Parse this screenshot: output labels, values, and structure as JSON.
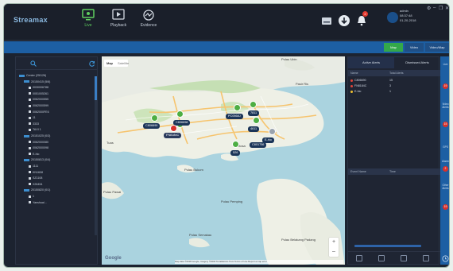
{
  "app": {
    "logo_main": "Streamax",
    "logo_accent": ""
  },
  "nav": [
    {
      "label": "Live",
      "icon": "monitor-icon",
      "active": true
    },
    {
      "label": "Playback",
      "icon": "play-icon",
      "active": false
    },
    {
      "label": "Evidence",
      "icon": "evidence-icon",
      "active": false
    }
  ],
  "topright": {
    "storage_icon": "storage-icon",
    "download_icon": "download-icon",
    "alarm_icon": "bell-icon",
    "alarm_count": "2"
  },
  "user": {
    "name": "admin",
    "time": "08:37:48",
    "date": "01-20-2018"
  },
  "window_controls": {
    "settings": "⚙",
    "minimize": "–",
    "restore": "❐",
    "close": "✕"
  },
  "view_tabs": [
    {
      "label": "Map",
      "active": true
    },
    {
      "label": "Video",
      "active": false
    },
    {
      "label": "Video/Map",
      "active": false
    }
  ],
  "tree": {
    "items": [
      {
        "label": "Center (25/126)",
        "level": 0,
        "type": "root"
      },
      {
        "label": "20150415 (5/6)",
        "level": 1,
        "type": "group"
      },
      {
        "label": "0030006788",
        "level": 2,
        "type": "vehicle"
      },
      {
        "label": "0051005261",
        "level": 2,
        "type": "vehicle"
      },
      {
        "label": "0062000555",
        "level": 2,
        "type": "vehicle"
      },
      {
        "label": "0062000599",
        "level": 2,
        "type": "vehicle"
      },
      {
        "label": "0062000FE6",
        "level": 2,
        "type": "vehicle"
      },
      {
        "label": "11",
        "level": 2,
        "type": "vehicle"
      },
      {
        "label": "3333",
        "level": 2,
        "type": "vehicle"
      },
      {
        "label": "TAXI 1",
        "level": 2,
        "type": "vehicle"
      },
      {
        "label": "20151025 (0/3)",
        "level": 1,
        "type": "group"
      },
      {
        "label": "0062000080",
        "level": 2,
        "type": "vehicle"
      },
      {
        "label": "0062000098",
        "level": 2,
        "type": "vehicle"
      },
      {
        "label": "E-hio",
        "level": 2,
        "type": "vehicle"
      },
      {
        "label": "20150813 (0/4)",
        "level": 1,
        "type": "group"
      },
      {
        "label": "1111",
        "level": 2,
        "type": "vehicle"
      },
      {
        "label": "KN1608",
        "level": 2,
        "type": "vehicle"
      },
      {
        "label": "SZ1108",
        "level": 2,
        "type": "vehicle"
      },
      {
        "label": "X26454",
        "level": 2,
        "type": "vehicle"
      },
      {
        "label": "20150820 (0/1)",
        "level": 1,
        "type": "group"
      },
      {
        "label": "1",
        "level": 2,
        "type": "vehicle"
      },
      {
        "label": "Yanshuai...",
        "level": 2,
        "type": "vehicle"
      }
    ]
  },
  "map": {
    "map_btn": "Map",
    "sat_btn": "Satellite",
    "places": [
      {
        "name": "Pulau Ubin",
        "color": "#3a3a3a"
      },
      {
        "name": "Pasir Ris",
        "color": "#3a3a3a"
      },
      {
        "name": "Pulau Semakau",
        "color": "#3a3a3a"
      },
      {
        "name": "Pulau Pawai",
        "color": "#3a3a3a"
      },
      {
        "name": "Pulau Bukom",
        "color": "#3a3a3a"
      },
      {
        "name": "Pulau Pemping",
        "color": "#3a3a3a"
      },
      {
        "name": "Pulau Belakang Padang",
        "color": "#3a3a3a"
      },
      {
        "name": "Tuas",
        "color": "#3a3a3a"
      },
      {
        "name": "Sentosa",
        "color": "#3a3a3a"
      }
    ],
    "vehicles": [
      {
        "label": "C806690",
        "status": "online"
      },
      {
        "label": "C806698",
        "status": "online"
      },
      {
        "label": "FN8184C",
        "status": "alarm"
      },
      {
        "label": "PC0568J",
        "status": "online"
      },
      {
        "label": "7811",
        "status": "online"
      },
      {
        "label": "4611",
        "status": "online"
      },
      {
        "label": "C801756",
        "status": "online"
      },
      {
        "label": "E-hio",
        "status": "online"
      },
      {
        "label": "526",
        "status": "online"
      }
    ],
    "google": "Google",
    "zoom_in": "+",
    "zoom_out": "–",
    "attribution": "Map data ©2018 Google, Imagery ©2018 TerraMetrics  5 km  Terms of Use  Report a map error"
  },
  "alerts": {
    "tabs": [
      {
        "label": "Active Alerts",
        "active": true
      },
      {
        "label": "Dismissed Alerts",
        "active": false
      }
    ],
    "headers": [
      "Name",
      "Total Alerts"
    ],
    "rows": [
      {
        "name": "C806690",
        "count": "15",
        "color": "#e0453a"
      },
      {
        "name": "FN8184C",
        "count": "3",
        "color": "#e0453a"
      },
      {
        "name": "E-hio",
        "count": "1",
        "color": "#f0c030"
      }
    ],
    "event_headers": [
      "Event Name",
      "Time"
    ]
  },
  "sidebar": [
    {
      "label": "Live",
      "badge": "19"
    },
    {
      "label": "Video Alerts",
      "badge": "15"
    },
    {
      "label": "GPS",
      "badge": ""
    },
    {
      "label": "Alarms",
      "badge": "2"
    },
    {
      "label": "Other Alerts",
      "badge": "19"
    }
  ]
}
